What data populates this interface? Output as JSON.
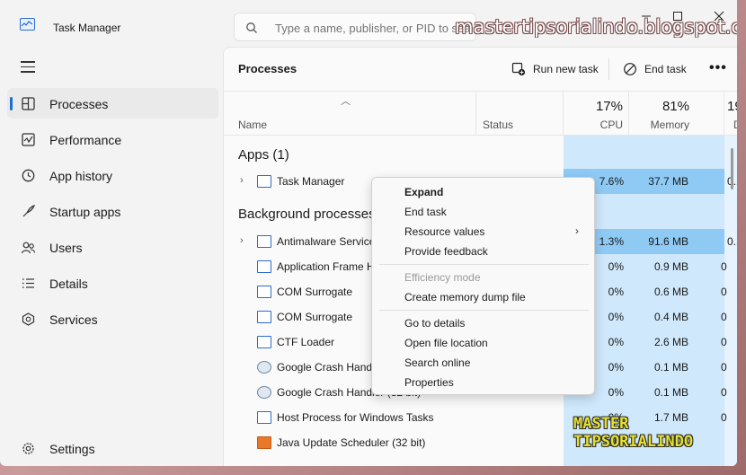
{
  "app": {
    "title": "Task Manager"
  },
  "search": {
    "placeholder": "Type a name, publisher, or PID to search"
  },
  "watermark": "mastertipsorialindo.blogspot.com",
  "logo_watermark": {
    "line1": "MASTER",
    "line2": "TIPSORIALINDO"
  },
  "sidebar": {
    "items": [
      {
        "label": "Processes",
        "icon": "processes-icon",
        "active": true
      },
      {
        "label": "Performance",
        "icon": "performance-icon"
      },
      {
        "label": "App history",
        "icon": "history-icon"
      },
      {
        "label": "Startup apps",
        "icon": "startup-icon"
      },
      {
        "label": "Users",
        "icon": "users-icon"
      },
      {
        "label": "Details",
        "icon": "details-icon"
      },
      {
        "label": "Services",
        "icon": "services-icon"
      }
    ],
    "settings": "Settings"
  },
  "main": {
    "title": "Processes",
    "run_new_task": "Run new task",
    "end_task": "End task",
    "more": "•••",
    "columns": {
      "name": "Name",
      "status": "Status",
      "cpu_pct": "17%",
      "cpu_label": "CPU",
      "mem_pct": "81%",
      "mem_label": "Memory",
      "disk_pct": "19",
      "disk_label": "D"
    },
    "groups": {
      "apps": "Apps (1)",
      "background": "Background processes"
    },
    "apps": [
      {
        "name": "Task Manager",
        "cpu": "7.6%",
        "memory": "37.7 MB",
        "disk": "0.1"
      }
    ],
    "background": [
      {
        "name": "Antimalware Service Executable",
        "cpu": "1.3%",
        "memory": "91.6 MB",
        "disk": "0.1",
        "expandable": true
      },
      {
        "name": "Application Frame Host",
        "cpu": "0%",
        "memory": "0.9 MB",
        "disk": "0"
      },
      {
        "name": "COM Surrogate",
        "cpu": "0%",
        "memory": "0.6 MB",
        "disk": "0"
      },
      {
        "name": "COM Surrogate",
        "cpu": "0%",
        "memory": "0.4 MB",
        "disk": "0"
      },
      {
        "name": "CTF Loader",
        "cpu": "0%",
        "memory": "2.6 MB",
        "disk": "0"
      },
      {
        "name": "Google Crash Handler",
        "cpu": "0%",
        "memory": "0.1 MB",
        "disk": "0"
      },
      {
        "name": "Google Crash Handler (32 bit)",
        "cpu": "0%",
        "memory": "0.1 MB",
        "disk": "0"
      },
      {
        "name": "Host Process for Windows Tasks",
        "cpu": "0%",
        "memory": "1.7 MB",
        "disk": "0"
      },
      {
        "name": "Java Update Scheduler (32 bit)",
        "cpu": "0%",
        "memory": "",
        "disk": ""
      }
    ]
  },
  "context_menu": {
    "expand": "Expand",
    "end_task": "End task",
    "resource_values": "Resource values",
    "provide_feedback": "Provide feedback",
    "efficiency_mode": "Efficiency mode",
    "create_dump": "Create memory dump file",
    "go_to_details": "Go to details",
    "open_file_location": "Open file location",
    "search_online": "Search online",
    "properties": "Properties"
  },
  "colors": {
    "accent": "#1f6fd1",
    "heat_high": "#8fcaf5",
    "heat_low": "#cfe8fb"
  }
}
